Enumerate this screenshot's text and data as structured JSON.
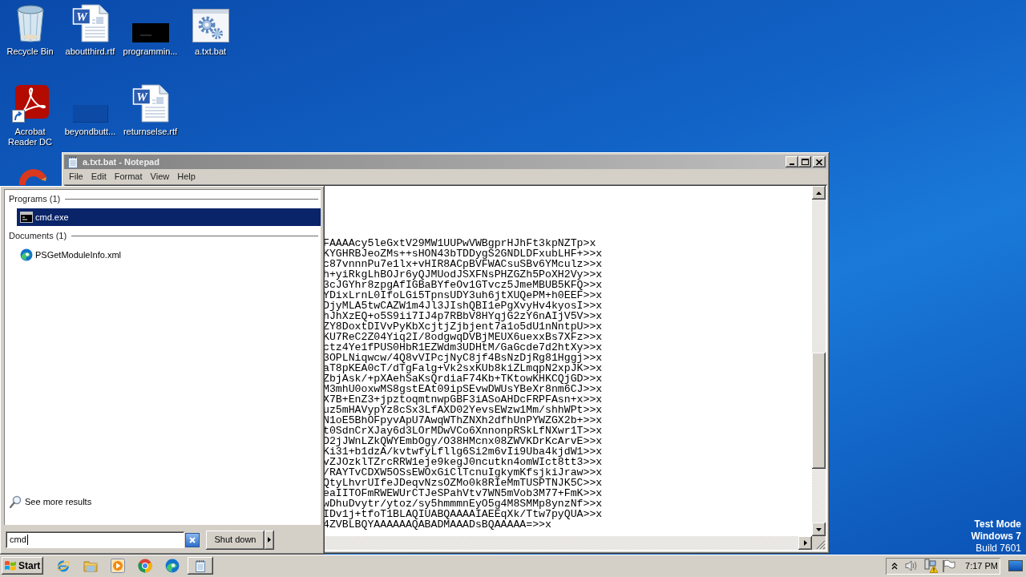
{
  "desktop": {
    "icon_rows": [
      [
        {
          "label": "Recycle Bin",
          "kind": "recycle-bin"
        },
        {
          "label": "aboutthird.rtf",
          "kind": "word-document",
          "badge": "W"
        },
        {
          "label": "programmin...",
          "kind": "dark-thumbnail"
        },
        {
          "label": "a.txt.bat",
          "kind": "batch-file"
        }
      ],
      [
        {
          "label": "Acrobat Reader DC",
          "kind": "acrobat-shortcut"
        },
        {
          "label": "beyondbutt...",
          "kind": "blank-thumbnail"
        },
        {
          "label": "returnselse.rtf",
          "kind": "word-document",
          "badge": "W"
        }
      ]
    ],
    "notice": [
      {
        "text": "Test Mode",
        "bold": true
      },
      {
        "text": "Windows 7",
        "bold": true
      },
      {
        "text": "Build 7601",
        "bold": false
      }
    ]
  },
  "notepad": {
    "title": "a.txt.bat - Notepad",
    "menu": [
      "File",
      "Edit",
      "Format",
      "View",
      "Help"
    ],
    "lines": [
      "FAAAAcy5leGxtV29MW1UUPwVWBgprHJhFt3kpNZTp>x",
      "KYGHRBJeoZMs++sHON43bTDDygS2GNDLDFxubLHF+>>x",
      "c87vnnnPu7e1lx+vHIR8ACpBVFWACsuSBv6YMculz>>x",
      "h+yiRkgLhBOJr6yQJMUodJSXFNsPHZGZh5PoXH2Vy>>x",
      "3cJGYhr8zpgAfIGBaBYfeOv1GTvcz5JmeMBUB5KFQ>>x",
      "YDixLrnL0IfoLGi5TpnsUDY3uh6jtXUQePM+h0EEF>>x",
      "DjyMLA5twCAZW1m4Jl3JIshQBI1ePgXvyHv4kyosI>>x",
      "hJhXzEQ+o5S9ii7IJ4p7RBbV8HYqjG2zY6nAIjV5V>>x",
      "ZY8DoxtDIVvPyKbXcjtjZjbjent7a1o5dU1nNntpU>>x",
      "KU7ReC2Z04Yiq2I/8odgwqDVBjMEUX6uexxBs7XFz>>x",
      "ctz4Ye1fPUS0HbR1EZWdm3UDHtM/GaGcde7d2htXy>>x",
      "3OPLNiqwcw/4Q8vVIPcjNyC8jf4BsNzDjRg81Hggj>>x",
      "aT8pKEA0cT/dTgFalg+Vk2sxKUb8kiZLmqpN2xpJK>>x",
      "ZbjAsk/+pXAehSaKsQrdiaF74Kb+TKtowKHKCQjGD>>x",
      "M3mhU0oxwMS8gstEAt09ipSEvwDWUsYBeXr8nm6CJ>>x",
      "X7B+EnZ3+jpztoqmtnwpGBF3iASoAHDcFRPFAsn+x>>x",
      "uz5mHAVypYz8cSx3LfAXD02YevsEWzw1Mm/shhWPt>>x",
      "N1oE5BhOFpyvApU7AwqWThZNXh2dfhUnPYWZGX2b+>>x",
      "t0SdnCrXJay6d3LOrMDwVCo6XnnonpRSkLfNXwr1T>>x",
      "D2jJWnLZkQWYEmbOgy/O38HMcnx08ZWVKDrKcArvE>>x",
      "Ki31+b1dzA/kvtwfyLfllg6Si2m6vIi9Uba4kjdW1>>x",
      "vZJOzklTZrcRRW1eje9kegJ0ncutkn4omWIct8tt3>>x",
      "/RAYTvCDXW5OSsEWOxGiClTcnuIgkymKfsjkiJraw>>x",
      "QtyLhvrUIfeJDeqvNzsOZMo0k8RIeMmTUSPTNJK5C>>x",
      "eaIITOFmRWEWUrCTJeSPahVtv7WN5mVob3M77+FmK>>x",
      "wDhuDvytr/ytoz/sy5hmmmnEyO5g4M8SMMp8ynzNf>>x",
      "IDv1j+tfoT1BLAQIUABQAAAAIAEEqXk/Ttw7pyQUA>>x",
      "4ZVBLBQYAAAAAAQABADMAAADsBQAAAAA=>>x"
    ]
  },
  "start_menu": {
    "groups": [
      {
        "heading": "Programs (1)",
        "items": [
          {
            "label": "cmd.exe",
            "kind": "console",
            "selected": true
          }
        ]
      },
      {
        "heading": "Documents (1)",
        "items": [
          {
            "label": "PSGetModuleInfo.xml",
            "kind": "edge-document",
            "selected": false
          }
        ]
      }
    ],
    "see_more": "See more results",
    "search": {
      "value": "cmd"
    },
    "shut_down": "Shut down"
  },
  "taskbar": {
    "start": "Start",
    "clock": "7:17 PM"
  }
}
